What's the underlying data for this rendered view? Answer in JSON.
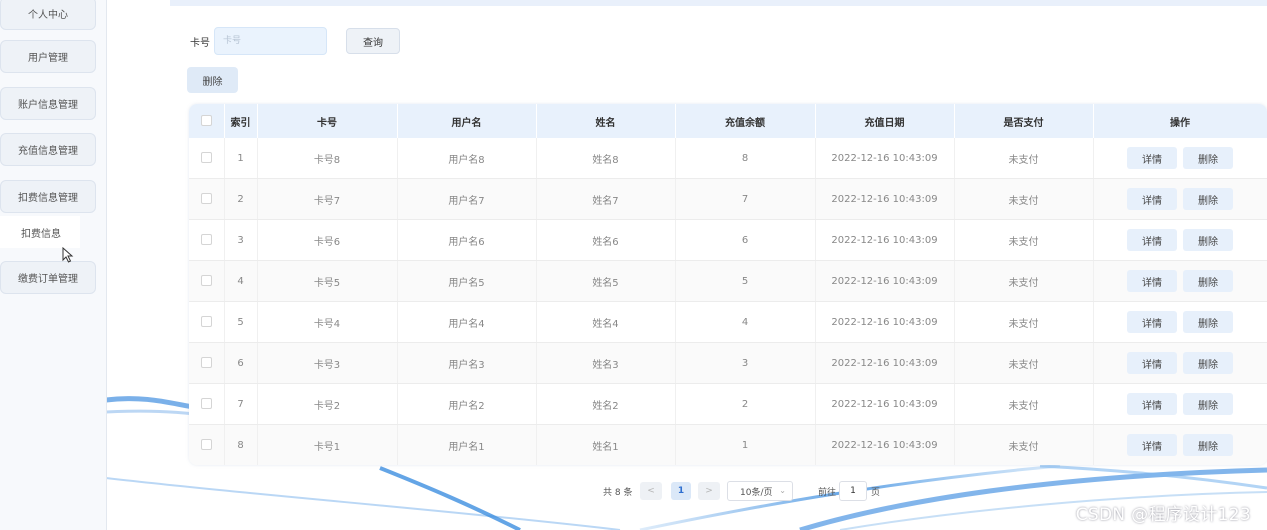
{
  "sidebar": {
    "items": [
      {
        "label": "个人中心"
      },
      {
        "label": "用户管理"
      },
      {
        "label": "账户信息管理"
      },
      {
        "label": "充值信息管理"
      },
      {
        "label": "扣费信息管理"
      },
      {
        "label": "缴费订单管理"
      }
    ],
    "submenu": {
      "label": "扣费信息"
    }
  },
  "search": {
    "label": "卡号",
    "placeholder": "卡号",
    "query_label": "查询"
  },
  "toolbar": {
    "delete_label": "删除"
  },
  "table": {
    "columns": [
      "索引",
      "卡号",
      "用户名",
      "姓名",
      "充值余额",
      "充值日期",
      "是否支付",
      "操作"
    ],
    "rows": [
      {
        "index": "1",
        "card": "卡号8",
        "username": "用户名8",
        "name": "姓名8",
        "balance": "8",
        "date": "2022-12-16 10:43:09",
        "paid": "未支付"
      },
      {
        "index": "2",
        "card": "卡号7",
        "username": "用户名7",
        "name": "姓名7",
        "balance": "7",
        "date": "2022-12-16 10:43:09",
        "paid": "未支付"
      },
      {
        "index": "3",
        "card": "卡号6",
        "username": "用户名6",
        "name": "姓名6",
        "balance": "6",
        "date": "2022-12-16 10:43:09",
        "paid": "未支付"
      },
      {
        "index": "4",
        "card": "卡号5",
        "username": "用户名5",
        "name": "姓名5",
        "balance": "5",
        "date": "2022-12-16 10:43:09",
        "paid": "未支付"
      },
      {
        "index": "5",
        "card": "卡号4",
        "username": "用户名4",
        "name": "姓名4",
        "balance": "4",
        "date": "2022-12-16 10:43:09",
        "paid": "未支付"
      },
      {
        "index": "6",
        "card": "卡号3",
        "username": "用户名3",
        "name": "姓名3",
        "balance": "3",
        "date": "2022-12-16 10:43:09",
        "paid": "未支付"
      },
      {
        "index": "7",
        "card": "卡号2",
        "username": "用户名2",
        "name": "姓名2",
        "balance": "2",
        "date": "2022-12-16 10:43:09",
        "paid": "未支付"
      },
      {
        "index": "8",
        "card": "卡号1",
        "username": "用户名1",
        "name": "姓名1",
        "balance": "1",
        "date": "2022-12-16 10:43:09",
        "paid": "未支付"
      }
    ],
    "detail_label": "详情",
    "delete_label": "删除"
  },
  "pagination": {
    "total_text": "共 8 条",
    "prev": "<",
    "current_page": "1",
    "next": ">",
    "page_size": "10条/页",
    "goto_label": "前往",
    "goto_value": "1",
    "page_suffix": "页"
  },
  "watermark": "CSDN @程序设计123",
  "colors": {
    "accent": "#2f6fd0",
    "header_bg": "#e8f1fc",
    "button_bg": "#e7f0fb"
  }
}
